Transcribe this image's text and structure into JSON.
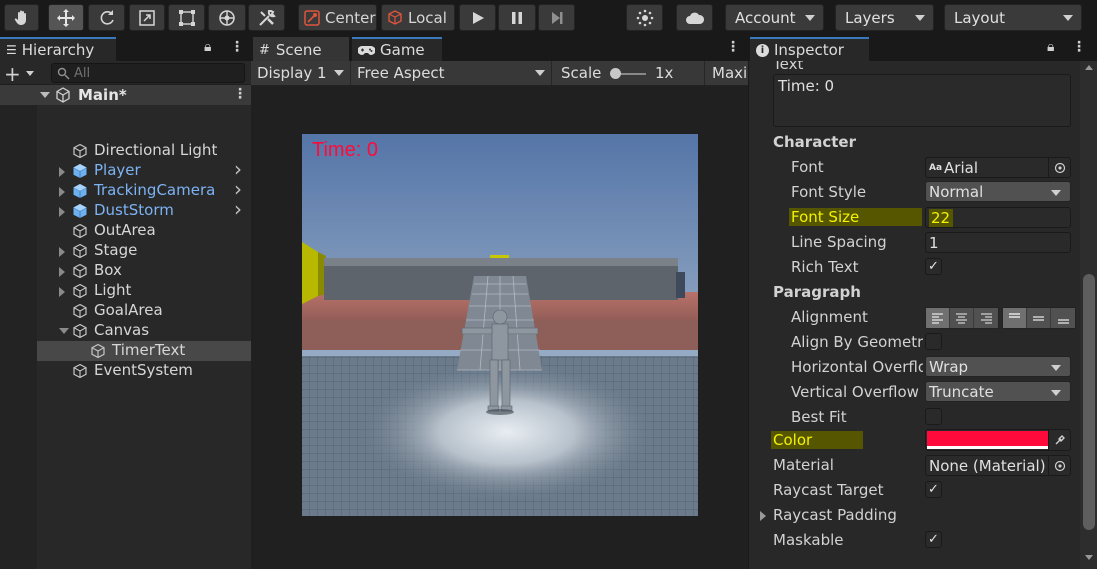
{
  "toolbar": {
    "pivot_label": "Center",
    "space_label": "Local",
    "account_label": "Account",
    "layers_label": "Layers",
    "layout_label": "Layout"
  },
  "hierarchy": {
    "tab_label": "Hierarchy",
    "search_placeholder": "All",
    "scene_name": "Main*",
    "items": [
      {
        "label": "Directional Light",
        "prefab": false
      },
      {
        "label": "Player",
        "prefab": true
      },
      {
        "label": "TrackingCamera",
        "prefab": true
      },
      {
        "label": "DustStorm",
        "prefab": true
      },
      {
        "label": "OutArea",
        "prefab": false
      },
      {
        "label": "Stage",
        "prefab": false
      },
      {
        "label": "Box",
        "prefab": false
      },
      {
        "label": "Light",
        "prefab": false
      },
      {
        "label": "GoalArea",
        "prefab": false
      },
      {
        "label": "Canvas",
        "prefab": false
      },
      {
        "label": "TimerText",
        "prefab": false,
        "selected": true
      },
      {
        "label": "EventSystem",
        "prefab": false
      }
    ]
  },
  "game": {
    "scene_tab_label": "Scene",
    "game_tab_label": "Game",
    "display_label": "Display 1",
    "aspect_label": "Free Aspect",
    "scale_label": "Scale",
    "scale_value": "1x",
    "maximize_label": "Maxi",
    "timer_text": "Time: 0"
  },
  "inspector": {
    "tab_label": "Inspector",
    "text_section_label": "Text",
    "text_value": "Time: 0",
    "character_header": "Character",
    "font_label": "Font",
    "font_value": "Arial",
    "font_icon_text": "Aa",
    "font_style_label": "Font Style",
    "font_style_value": "Normal",
    "font_size_label": "Font Size",
    "font_size_value": "22",
    "line_spacing_label": "Line Spacing",
    "line_spacing_value": "1",
    "rich_text_label": "Rich Text",
    "rich_text_checked": true,
    "paragraph_header": "Paragraph",
    "alignment_label": "Alignment",
    "align_by_geometry_label": "Align By Geometry",
    "horizontal_overflow_label": "Horizontal Overflo",
    "horizontal_overflow_value": "Wrap",
    "vertical_overflow_label": "Vertical Overflow",
    "vertical_overflow_value": "Truncate",
    "best_fit_label": "Best Fit",
    "color_label": "Color",
    "color_value": "#ff0a3a",
    "material_label": "Material",
    "material_value": "None (Material)",
    "raycast_target_label": "Raycast Target",
    "raycast_padding_label": "Raycast Padding",
    "maskable_label": "Maskable"
  },
  "colors": {
    "accent": "#3a79bb",
    "prefab_text": "#7cb3f4",
    "highlight_bg": "#565600",
    "highlight_text": "#f3f300",
    "timer_red": "#ff0a3a"
  }
}
